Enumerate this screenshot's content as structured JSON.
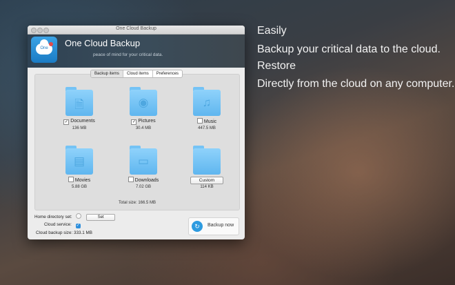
{
  "hero": {
    "heading1": "Easily",
    "sub1": "Backup your critical data to the cloud.",
    "heading2": "Restore",
    "sub2": "Directly from the cloud on any computer."
  },
  "window": {
    "title": "One Cloud Backup",
    "app_title": "One Cloud Backup",
    "tagline": "peace of mind for your critical data.",
    "icon_text": "One"
  },
  "tabs": [
    "Backup items",
    "Cloud items",
    "Preferences"
  ],
  "items": [
    {
      "label": "Documents",
      "size": "136 MB",
      "checked": true,
      "icon": "document-icon"
    },
    {
      "label": "Pictures",
      "size": "30.4 MB",
      "checked": true,
      "icon": "camera-icon"
    },
    {
      "label": "Music",
      "size": "447.5 MB",
      "checked": false,
      "icon": "music-icon"
    },
    {
      "label": "Movies",
      "size": "5.88 GB",
      "checked": false,
      "icon": "film-icon"
    },
    {
      "label": "Downloads",
      "size": "7.02 GB",
      "checked": false,
      "icon": "downloads-icon"
    },
    {
      "label": "Custom",
      "size": "114 KB",
      "checked": false,
      "icon": "folder-icon"
    }
  ],
  "total": "Total size: 166.5 MB",
  "footer": {
    "home_label": "Home directory set:",
    "set_button": "Set",
    "cloud_service_label": "Cloud service:",
    "backup_size_label": "Cloud backup size:",
    "backup_size_value": "333.1 MB"
  },
  "backup_button": "Backup now"
}
